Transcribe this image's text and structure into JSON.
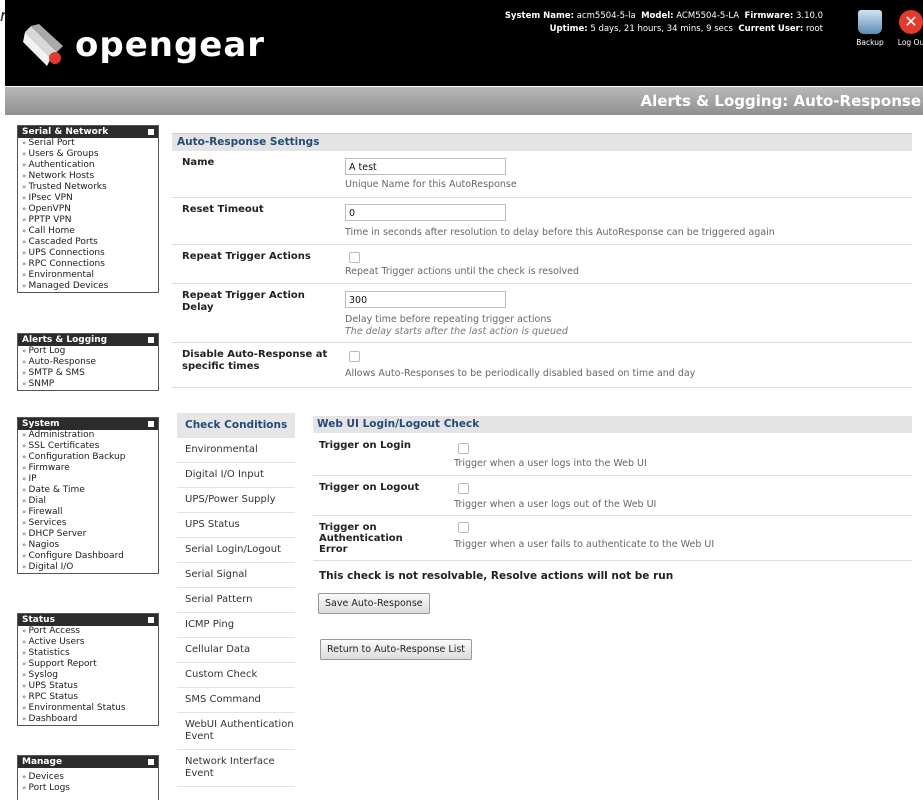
{
  "stray_text": "r",
  "header": {
    "logo_text": "opengear",
    "system_name_label": "System Name:",
    "system_name": "acm5504-5-la",
    "model_label": "Model:",
    "model": "ACM5504-5-LA",
    "firmware_label": "Firmware:",
    "firmware": "3.10.0",
    "uptime_label": "Uptime:",
    "uptime": "5 days, 21 hours, 34 mins, 9 secs",
    "current_user_label": "Current User:",
    "current_user": "root",
    "backup_label": "Backup",
    "logout_label": "Log Ou"
  },
  "page_title": "Alerts & Logging: Auto-Response",
  "menus": {
    "serial": {
      "title": "Serial & Network",
      "items": [
        "Serial Port",
        "Users & Groups",
        "Authentication",
        "Network Hosts",
        "Trusted Networks",
        "IPsec VPN",
        "OpenVPN",
        "PPTP VPN",
        "Call Home",
        "Cascaded Ports",
        "UPS Connections",
        "RPC Connections",
        "Environmental",
        "Managed Devices"
      ]
    },
    "alerts": {
      "title": "Alerts & Logging",
      "items": [
        "Port Log",
        "Auto-Response",
        "SMTP & SMS",
        "SNMP"
      ]
    },
    "system": {
      "title": "System",
      "items": [
        "Administration",
        "SSL Certificates",
        "Configuration Backup",
        "Firmware",
        "IP",
        "Date & Time",
        "Dial",
        "Firewall",
        "Services",
        "DHCP Server",
        "Nagios",
        "Configure Dashboard",
        "Digital I/O"
      ]
    },
    "status": {
      "title": "Status",
      "items": [
        "Port Access",
        "Active Users",
        "Statistics",
        "Support Report",
        "Syslog",
        "UPS Status",
        "RPC Status",
        "Environmental Status",
        "Dashboard"
      ]
    },
    "manage": {
      "title": "Manage",
      "items": [
        "Devices",
        "Port Logs"
      ]
    }
  },
  "settings": {
    "title": "Auto-Response Settings",
    "name_label": "Name",
    "name_value": "A test",
    "name_help": "Unique Name for this AutoResponse",
    "reset_label": "Reset Timeout",
    "reset_value": "0",
    "reset_help": "Time in seconds after resolution to delay before this AutoResponse can be triggered again",
    "repeat_label": "Repeat Trigger Actions",
    "repeat_help": "Repeat Trigger actions until the check is resolved",
    "delay_label": "Repeat Trigger Action Delay",
    "delay_value": "300",
    "delay_help": "Delay time before repeating trigger actions",
    "delay_help2": "The delay starts after the last action is queued",
    "disable_label": "Disable Auto-Response at specific times",
    "disable_help": "Allows Auto-Responses to be periodically disabled based on time and day"
  },
  "check_conditions": {
    "title": "Check Conditions",
    "items": [
      "Environmental",
      "Digital I/O Input",
      "UPS/Power Supply",
      "UPS Status",
      "Serial Login/Logout",
      "Serial Signal",
      "Serial Pattern",
      "ICMP Ping",
      "Cellular Data",
      "Custom Check",
      "SMS Command",
      "WebUI Authentication Event",
      "Network Interface Event"
    ]
  },
  "webui_check": {
    "title": "Web UI Login/Logout Check",
    "login_label": "Trigger on Login",
    "login_help": "Trigger when a user logs into the Web UI",
    "logout_label": "Trigger on Logout",
    "logout_help": "Trigger when a user logs out of the Web UI",
    "auth_label": "Trigger on Authentication Error",
    "auth_help": "Trigger when a user fails to authenticate to the Web UI",
    "note": "This check is not resolvable, Resolve actions will not be run",
    "save_button": "Save Auto-Response",
    "return_button": "Return to Auto-Response List"
  }
}
